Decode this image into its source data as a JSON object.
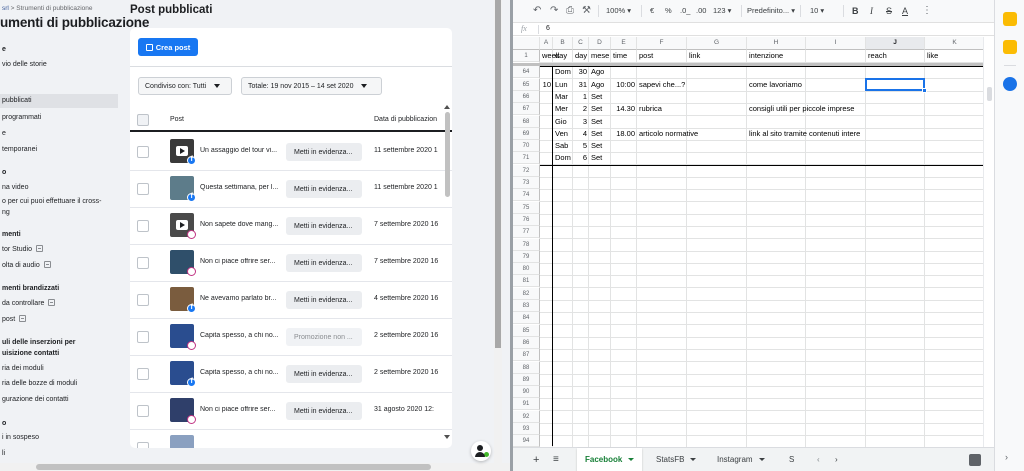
{
  "fb": {
    "breadcrumb_prefix": "srl",
    "breadcrumb_sep": ">",
    "breadcrumb_current": "Strumenti di pubblicazione",
    "page_title": "umenti di pubblicazione",
    "sidebar": [
      {
        "label": "e",
        "bold": true
      },
      {
        "label": "vio delle storie"
      },
      {
        "label": "pubblicati",
        "active": true
      },
      {
        "label": "programmati"
      },
      {
        "label": "e"
      },
      {
        "label": "temporanei"
      },
      {
        "label": "o",
        "bold": true
      },
      {
        "label": "na video"
      },
      {
        "label": "o per cui puoi effettuare il cross-"
      },
      {
        "label": "ng"
      },
      {
        "label": "menti",
        "bold": true
      },
      {
        "label": "tor Studio",
        "mini": true
      },
      {
        "label": "olta di audio",
        "mini": true
      },
      {
        "label": "menti brandizzati",
        "bold": true
      },
      {
        "label": "da controllare",
        "mini": true
      },
      {
        "label": "post",
        "mini": true
      },
      {
        "label": "uli delle inserzioni per",
        "bold": true
      },
      {
        "label": "uisizione contatti",
        "bold": true
      },
      {
        "label": "ria dei moduli"
      },
      {
        "label": "ria delle bozze di moduli"
      },
      {
        "label": "gurazione dei contatti"
      },
      {
        "label": "o",
        "bold": true
      },
      {
        "label": "i in sospeso"
      },
      {
        "label": "li"
      }
    ],
    "main_title": "Post pubblicati",
    "create_label": "Crea post",
    "shared_filter": "Condiviso con: Tutti",
    "total_filter": "Totale: 19 nov 2015 – 14 set 2020",
    "col_post": "Post",
    "col_date": "Data di pubblicazion",
    "rows": [
      {
        "text": "Un assaggio del tour vi...",
        "boost": "Metti in evidenza...",
        "date": "11 settembre 2020 1",
        "platform": "facebook",
        "thumb": "#3a3a3a",
        "play": true,
        "boost_disabled": false
      },
      {
        "text": "Questa settimana, per l...",
        "boost": "Metti in evidenza...",
        "date": "11 settembre 2020 1",
        "platform": "facebook",
        "thumb": "#5d7c8a",
        "play": false,
        "boost_disabled": false
      },
      {
        "text": "Non sapete dove mang...",
        "boost": "Metti in evidenza...",
        "date": "7 settembre 2020 16",
        "platform": "instagram",
        "thumb": "#4a4a4a",
        "play": true,
        "boost_disabled": false
      },
      {
        "text": "Non ci piace offrire ser...",
        "boost": "Metti in evidenza...",
        "date": "7 settembre 2020 16",
        "platform": "instagram",
        "thumb": "#2f4f6a",
        "play": false,
        "boost_disabled": false
      },
      {
        "text": "Ne avevamo parlato br...",
        "boost": "Metti in evidenza...",
        "date": "4 settembre 2020 16",
        "platform": "facebook",
        "thumb": "#7a5c3e",
        "play": false,
        "boost_disabled": false
      },
      {
        "text": "Capita spesso, a chi no...",
        "boost": "Promozione non ...",
        "date": "2 settembre 2020 16",
        "platform": "instagram",
        "thumb": "#2a4d8f",
        "play": false,
        "boost_disabled": true
      },
      {
        "text": "Capita spesso, a chi no...",
        "boost": "Metti in evidenza...",
        "date": "2 settembre 2020 16",
        "platform": "facebook",
        "thumb": "#2a4d8f",
        "play": false,
        "boost_disabled": false
      },
      {
        "text": "Non ci piace offrire ser...",
        "boost": "Metti in evidenza...",
        "date": "31 agosto 2020 12:",
        "platform": "instagram",
        "thumb": "#2f3f6a",
        "play": false,
        "boost_disabled": false
      },
      {
        "text": "",
        "boost": "",
        "date": "",
        "platform": "",
        "thumb": "#8aa0c0",
        "play": false,
        "boost_disabled": false
      }
    ]
  },
  "sheets": {
    "toolbar": {
      "zoom": "100%",
      "currency": "€",
      "percent": "%",
      "dec_less": ".0_",
      "dec_more": ".00",
      "format": "123",
      "font": "Predefinito...",
      "size": "10",
      "bold": "B",
      "italic": "I",
      "strike": "S",
      "color": "A"
    },
    "formula_label": "fx",
    "formula_value": "6",
    "columns": [
      "A",
      "B",
      "C",
      "D",
      "E",
      "F",
      "G",
      "H",
      "I",
      "J",
      "K"
    ],
    "selected_column": "J",
    "header_row": {
      "num": "1",
      "cells": [
        "week",
        "day",
        "day",
        "mese",
        "time",
        "post",
        "link",
        "intenzione",
        "",
        "reach",
        "like"
      ]
    },
    "rows": [
      {
        "num": "64",
        "cells": [
          "",
          "Dom",
          "30",
          "Ago",
          "",
          "",
          "",
          "",
          "",
          "",
          ""
        ]
      },
      {
        "num": "65",
        "cells": [
          "10",
          "Lun",
          "31",
          "Ago",
          "10:00",
          "sapevi che...?",
          "",
          "come lavoriamo",
          "",
          "",
          ""
        ]
      },
      {
        "num": "66",
        "cells": [
          "",
          "Mar",
          "1",
          "Set",
          "",
          "",
          "",
          "",
          "",
          "",
          ""
        ]
      },
      {
        "num": "67",
        "cells": [
          "",
          "Mer",
          "2",
          "Set",
          "14.30",
          "rubrica",
          "",
          "consigli utili per piccole imprese",
          "",
          "",
          ""
        ]
      },
      {
        "num": "68",
        "cells": [
          "",
          "Gio",
          "3",
          "Set",
          "",
          "",
          "",
          "",
          "",
          "",
          ""
        ]
      },
      {
        "num": "69",
        "cells": [
          "",
          "Ven",
          "4",
          "Set",
          "18.00",
          "articolo normative",
          "",
          "link al sito tramite contenuti intere",
          "",
          "",
          ""
        ]
      },
      {
        "num": "70",
        "cells": [
          "",
          "Sab",
          "5",
          "Set",
          "",
          "",
          "",
          "",
          "",
          "",
          ""
        ]
      },
      {
        "num": "71",
        "cells": [
          "",
          "Dom",
          "6",
          "Set",
          "",
          "",
          "",
          "",
          "",
          "",
          ""
        ]
      },
      {
        "num": "72",
        "cells": []
      },
      {
        "num": "73",
        "cells": []
      },
      {
        "num": "74",
        "cells": []
      },
      {
        "num": "75",
        "cells": []
      },
      {
        "num": "76",
        "cells": []
      },
      {
        "num": "77",
        "cells": []
      },
      {
        "num": "78",
        "cells": []
      },
      {
        "num": "79",
        "cells": []
      },
      {
        "num": "80",
        "cells": []
      },
      {
        "num": "81",
        "cells": []
      },
      {
        "num": "82",
        "cells": []
      },
      {
        "num": "83",
        "cells": []
      },
      {
        "num": "84",
        "cells": []
      },
      {
        "num": "85",
        "cells": []
      },
      {
        "num": "86",
        "cells": []
      },
      {
        "num": "87",
        "cells": []
      },
      {
        "num": "88",
        "cells": []
      },
      {
        "num": "89",
        "cells": []
      },
      {
        "num": "90",
        "cells": []
      },
      {
        "num": "91",
        "cells": []
      },
      {
        "num": "92",
        "cells": []
      },
      {
        "num": "93",
        "cells": []
      },
      {
        "num": "94",
        "cells": []
      }
    ],
    "tabs": [
      {
        "label": "Facebook",
        "active": true,
        "caret": true
      },
      {
        "label": "StatsFB",
        "active": false,
        "caret": true
      },
      {
        "label": "Instagram",
        "active": false,
        "caret": true
      },
      {
        "label": "S",
        "active": false,
        "caret": false
      }
    ],
    "add_sheet": "+",
    "all_sheets": "≡",
    "right_cells": [
      "reach",
      "like"
    ]
  },
  "colors": {
    "fb_blue": "#1877f2",
    "sheets_green": "#188038",
    "selection_blue": "#1a73e8"
  }
}
